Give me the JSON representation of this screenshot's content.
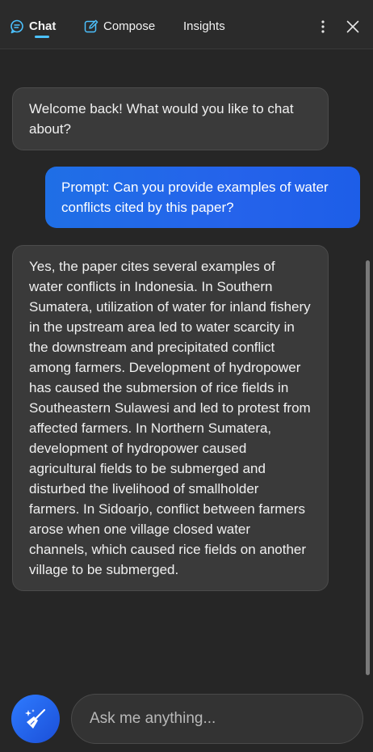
{
  "header": {
    "tabs": [
      {
        "label": "Chat",
        "icon": "chat-bubble-icon",
        "active": true
      },
      {
        "label": "Compose",
        "icon": "compose-icon",
        "active": false
      },
      {
        "label": "Insights",
        "icon": "",
        "active": false
      }
    ],
    "more_icon": "more-vertical-icon",
    "close_icon": "close-icon"
  },
  "messages": [
    {
      "role": "assistant",
      "text": "Welcome back! What would you like to chat about?"
    },
    {
      "role": "user",
      "text": "Prompt: Can you provide examples of water conflicts cited by this paper?"
    },
    {
      "role": "assistant",
      "text": "Yes, the paper cites several examples of water conflicts in Indonesia. In Southern Sumatera, utilization of water for inland fishery in the upstream area led to water scarcity in the downstream and precipitated conflict among farmers. Development of hydropower has caused the submersion of rice fields in Southeastern Sulawesi and led to protest from affected farmers. In Northern Sumatera, development of hydropower caused agricultural fields to be submerged and disturbed the livelihood of smallholder farmers. In Sidoarjo, conflict between farmers arose when one village closed water channels, which caused rice fields on another village to be submerged."
    }
  ],
  "composer": {
    "placeholder": "Ask me anything...",
    "value": "",
    "clear_icon": "broom-sparkle-icon"
  },
  "colors": {
    "background": "#262626",
    "header": "#2b2b2b",
    "bot_bubble": "#3a3a3a",
    "user_bubble": "#2563eb",
    "accent": "#4cc2ff"
  }
}
